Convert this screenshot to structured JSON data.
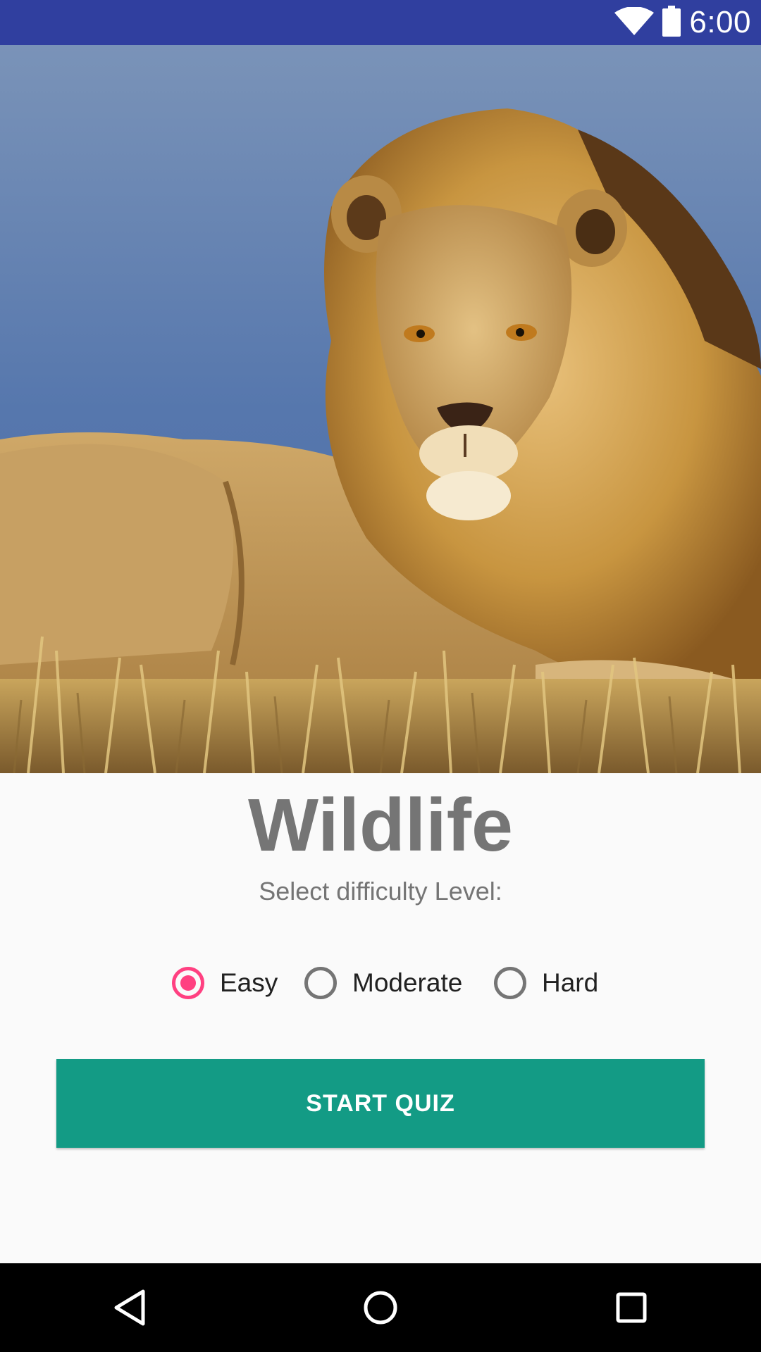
{
  "status_bar": {
    "time": "6:00",
    "color": "#303f9f",
    "icons": [
      "wifi-icon",
      "battery-icon"
    ]
  },
  "hero": {
    "image": "lion-photo",
    "description_icon": "lion-image"
  },
  "main": {
    "title": "Wildlife",
    "subtitle": "Select difficulty Level:",
    "difficulty_options": [
      {
        "label": "Easy",
        "checked": true
      },
      {
        "label": "Moderate",
        "checked": false
      },
      {
        "label": "Hard",
        "checked": false
      }
    ],
    "start_button_label": "START QUIZ",
    "accent_color": "#ff4081",
    "button_color": "#139b85"
  },
  "nav_bar": {
    "buttons": [
      "back-icon",
      "home-icon",
      "recents-icon"
    ]
  }
}
